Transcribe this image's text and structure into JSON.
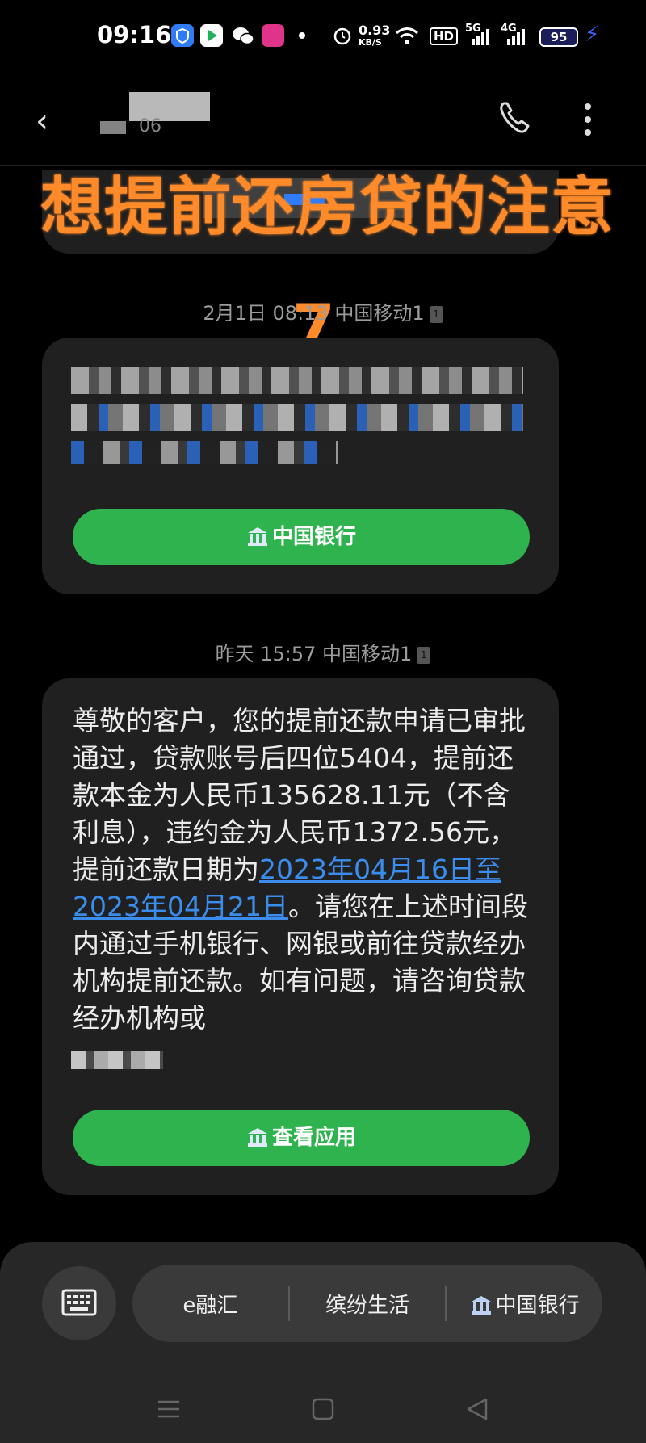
{
  "status_bar": {
    "time": "09:16",
    "net_speed_value": "0.93",
    "net_speed_unit": "KB/S",
    "hd_label": "HD",
    "signal1_label": "5G",
    "signal2_label": "4G",
    "battery": "95",
    "icons": [
      "shield-app-icon",
      "video-app-icon",
      "wechat-icon",
      "vip-app-icon",
      "dot-icon",
      "alarm-icon",
      "wifi-icon",
      "signal-icon",
      "charging-icon"
    ]
  },
  "header": {
    "contact_partial": "06",
    "icons": [
      "back-icon",
      "call-icon",
      "more-icon"
    ]
  },
  "overlay": {
    "title": "想提前还房贷的注意",
    "number": "7"
  },
  "messages": [
    {
      "timestamp": "2月1日 08:13 中国移动1",
      "text_visible": "",
      "button_label": "中国银行"
    },
    {
      "timestamp": "昨天 15:57 中国移动1",
      "text_pre": "尊敬的客户，您的提前还款申请已审批通过，贷款账号后四位5404，提前还款本金为人民币135628.11元（不含利息），违约金为人民币1372.56元，提前还款日期为",
      "text_link": "2023年04月16日至2023年04月21日",
      "text_post": "。请您在上述时间段内通过手机银行、网银或前往贷款经办机构提前还款。如有问题，请咨询贷款经办机构或",
      "button_label": "查看应用"
    }
  ],
  "bottom_menu": {
    "items": [
      "e融汇",
      "缤纷生活",
      "中国银行"
    ]
  },
  "colors": {
    "accent_green": "#2fb34e",
    "overlay_orange": "#ff8a29",
    "link_blue": "#3b8ded"
  }
}
